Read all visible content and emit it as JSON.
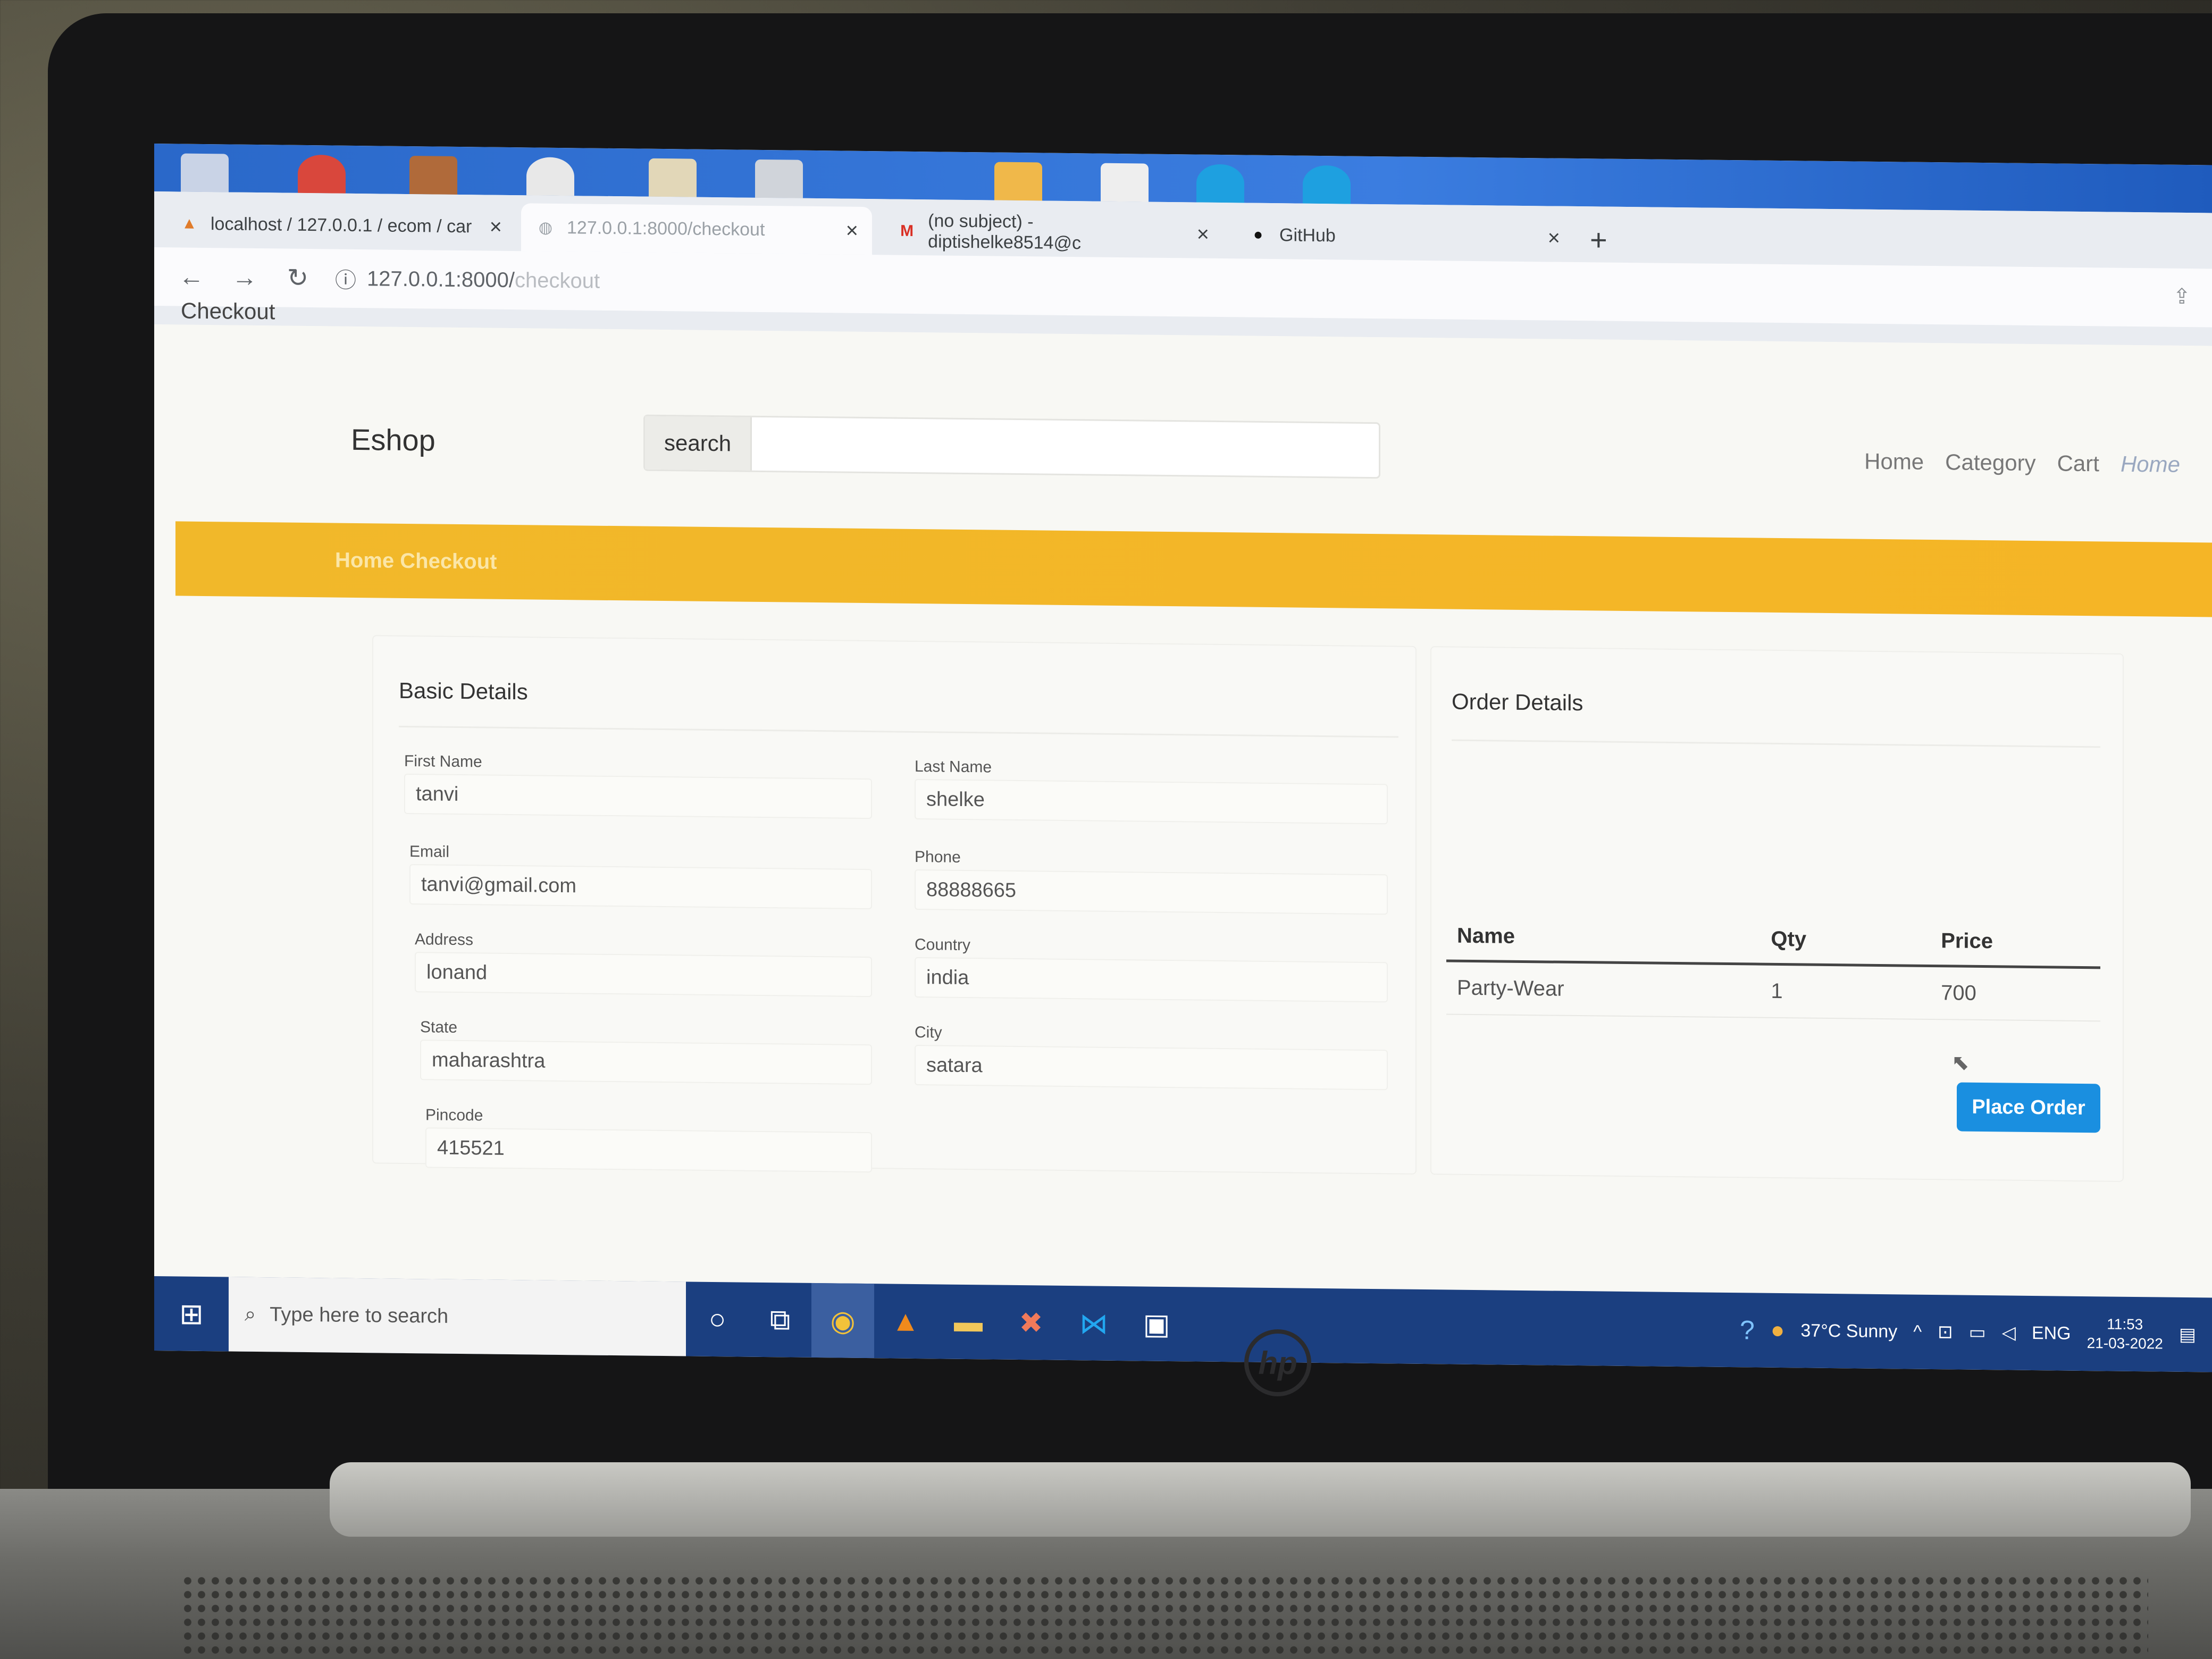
{
  "browser": {
    "tabs": [
      {
        "label": "localhost / 127.0.0.1 / ecom / car",
        "icon": "phpmyadmin-icon"
      },
      {
        "label": "127.0.0.1:8000/checkout",
        "icon": "globe-icon"
      },
      {
        "label": "(no subject) - diptishelke8514@c",
        "icon": "gmail-icon"
      },
      {
        "label": "GitHub",
        "icon": "github-icon"
      }
    ],
    "url_host": "127.0.0.1:8000/",
    "url_path": "checkout"
  },
  "page": {
    "doc_title": "Checkout",
    "brand": "Eshop",
    "search_label": "search",
    "search_placeholder": "",
    "nav": [
      "Home",
      "Category",
      "Cart",
      "Home"
    ],
    "breadcrumb": "Home Checkout"
  },
  "basic_details": {
    "title": "Basic Details",
    "fields": [
      {
        "label": "First Name",
        "value": "tanvi"
      },
      {
        "label": "Last Name",
        "value": "shelke"
      },
      {
        "label": "Email",
        "value": "tanvi@gmail.com"
      },
      {
        "label": "Phone",
        "value": "88888665"
      },
      {
        "label": "Address",
        "value": "lonand"
      },
      {
        "label": "Country",
        "value": "india"
      },
      {
        "label": "State",
        "value": "maharashtra"
      },
      {
        "label": "City",
        "value": "satara"
      },
      {
        "label": "Pincode",
        "value": "415521"
      }
    ]
  },
  "order_details": {
    "title": "Order Details",
    "columns": [
      "Name",
      "Qty",
      "Price"
    ],
    "rows": [
      [
        "Party-Wear",
        "1",
        "700"
      ]
    ],
    "place_order_label": "Place Order"
  },
  "taskbar": {
    "search_placeholder": "Type here to search",
    "weather": "37°C  Sunny",
    "language": "ENG",
    "time": "11:53",
    "date": "21-03-2022"
  },
  "colors": {
    "banner": "#f1b82a",
    "button": "#1a8fe0",
    "taskbar": "#1b3f80"
  }
}
